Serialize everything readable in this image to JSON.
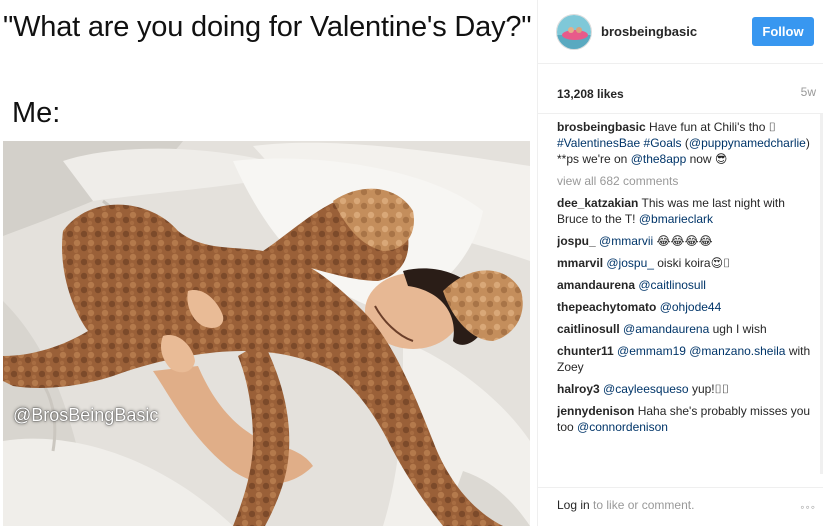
{
  "image": {
    "question": "\"What are you doing for Valentine's Day?\"",
    "me_label": "Me:",
    "watermark": "@BrosBeingBasic"
  },
  "header": {
    "username": "brosbeingbasic",
    "follow_label": "Follow",
    "accent_color": "#3897f0"
  },
  "stats": {
    "likes": "13,208 likes",
    "age": "5w"
  },
  "caption": {
    "author": "brosbeingbasic",
    "text_before": "Have fun at Chili's tho ",
    "emoji_box": "⌷",
    "hashtag_1": "#ValentinesBae",
    "hashtag_2": "#Goals",
    "mention_1": "@puppynamedcharlie",
    "text_middle": ") **ps we're on",
    "mention_2": "@the8app",
    "text_after": " now 😎"
  },
  "view_all": "view all 682 comments",
  "comments": [
    {
      "author": "dee_katzakian",
      "pre": "This was me last night with Bruce to the T!",
      "mention": "@bmarieclark",
      "post": ""
    },
    {
      "author": "jospu_",
      "pre": "",
      "mention": "@mmarvii",
      "post": " 😂😂😂😂"
    },
    {
      "author": "mmarvil",
      "pre": "",
      "mention": "@jospu_",
      "post": " oiski koira😍⌷"
    },
    {
      "author": "amandaurena",
      "pre": "",
      "mention": "@caitlinosull",
      "post": ""
    },
    {
      "author": "thepeachytomato",
      "pre": "",
      "mention": "@ohjode44",
      "post": ""
    },
    {
      "author": "caitlinosull",
      "pre": "",
      "mention": "@amandaurena",
      "post": " ugh I wish"
    },
    {
      "author": "chunter11",
      "pre": "",
      "mention": "@emmam19 @manzano.sheila",
      "post": " with Zoey"
    },
    {
      "author": "halroy3",
      "pre": "",
      "mention": "@cayleesqueso",
      "post": " yup!⌷⌷"
    },
    {
      "author": "jennydenison",
      "pre": "Haha she's probably misses you too",
      "mention": "@connordenison",
      "post": ""
    }
  ],
  "footer": {
    "login_link": "Log in",
    "login_rest": " to like or comment.",
    "more": "◦◦◦"
  }
}
